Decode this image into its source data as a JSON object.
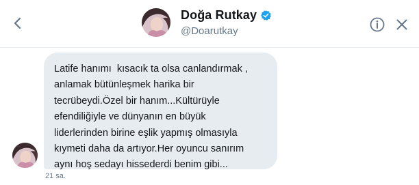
{
  "header": {
    "display_name": "Doğa Rutkay",
    "handle": "@Doarutkay"
  },
  "icons": {
    "back": "chevron-left-icon",
    "verified": "verified-badge-icon",
    "info": "info-icon",
    "close": "close-icon"
  },
  "colors": {
    "verified_badge": "#1da1f2",
    "icon": "#657786",
    "bubble_bg": "#e6ecf0",
    "text": "#14171a"
  },
  "message": {
    "lines": [
      "Latife hanımı  kısacık ta olsa canlandırmak ,",
      "anlamak bütünleşmek harika bir",
      "tecrübeydi.Özel bir hanım...Kültürüyle",
      "efendiliğiyle ve dünyanın en büyük",
      "liderlerinden birine eşlik yapmış olmasıyla",
      "kıymeti daha da artıyor.Her oyuncu sanırım",
      "aynı hoş sedayı hissederdi benim gibi..."
    ],
    "timestamp": "21 sa."
  }
}
